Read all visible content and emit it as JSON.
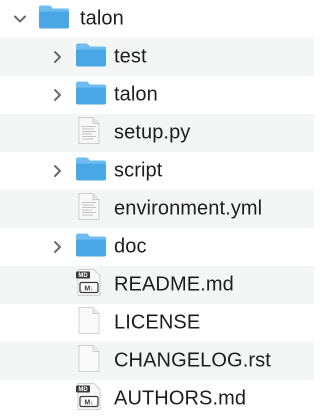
{
  "colors": {
    "folder_body": "#4aa7e6",
    "folder_tab": "#6fbdf0",
    "row_stripe": "#f4f5f5",
    "text": "#1d1d1f",
    "chevron": "#6b6b6b"
  },
  "tree": {
    "root": {
      "label": "talon",
      "type": "folder",
      "expanded": true,
      "chevron": "chevron-down-icon"
    },
    "items": [
      {
        "label": "test",
        "type": "folder",
        "expanded": false,
        "chevron": "chevron-right-icon"
      },
      {
        "label": "talon",
        "type": "folder",
        "expanded": false,
        "chevron": "chevron-right-icon"
      },
      {
        "label": "setup.py",
        "type": "text-file"
      },
      {
        "label": "script",
        "type": "folder",
        "expanded": false,
        "chevron": "chevron-right-icon"
      },
      {
        "label": "environment.yml",
        "type": "text-file"
      },
      {
        "label": "doc",
        "type": "folder",
        "expanded": false,
        "chevron": "chevron-right-icon"
      },
      {
        "label": "README.md",
        "type": "markdown-file",
        "badge_top": "MD",
        "badge_bottom": "M↓"
      },
      {
        "label": "LICENSE",
        "type": "blank-file"
      },
      {
        "label": "CHANGELOG.rst",
        "type": "blank-file"
      },
      {
        "label": "AUTHORS.md",
        "type": "markdown-file",
        "badge_top": "MD",
        "badge_bottom": "M↓"
      }
    ]
  }
}
